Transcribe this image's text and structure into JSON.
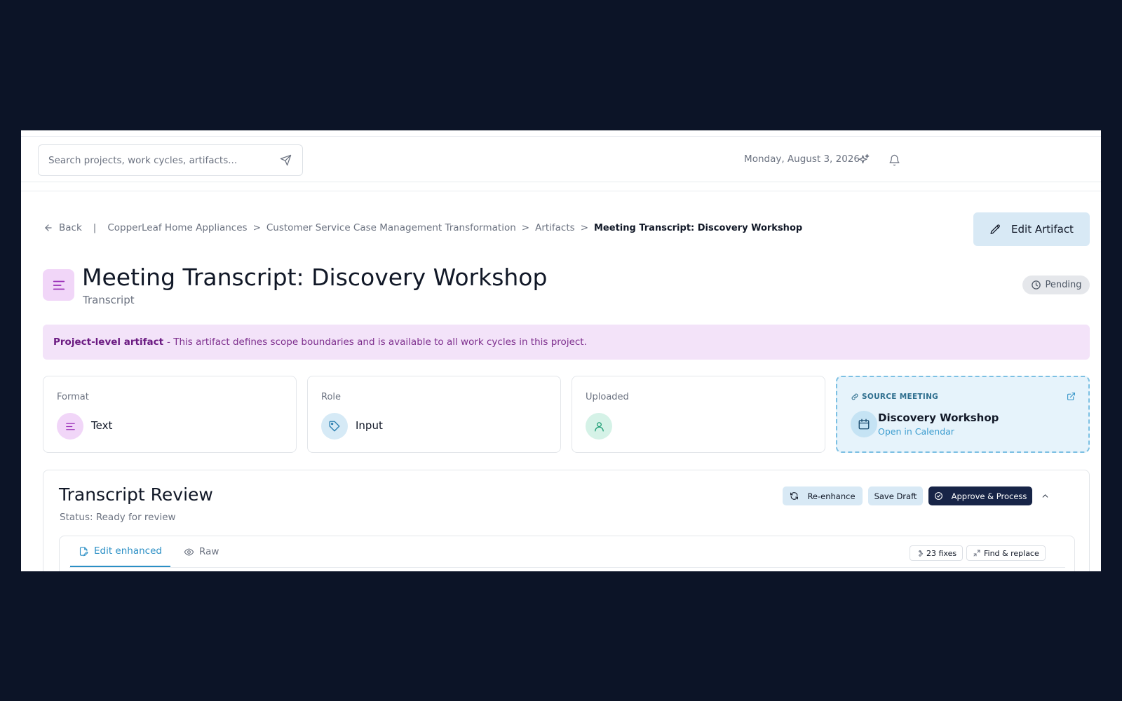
{
  "topbar": {
    "search_placeholder": "Search projects, work cycles, artifacts...",
    "date": "Monday, August 3, 2026",
    "icons": [
      "send-icon",
      "sparkles-icon",
      "bell-icon"
    ]
  },
  "breadcrumb": {
    "back": "Back",
    "separator": "|",
    "items": [
      "CopperLeaf Home Appliances",
      "Customer Service Case Management Transformation",
      "Artifacts"
    ],
    "current": "Meeting Transcript: Discovery Workshop",
    "chevron": ">"
  },
  "header": {
    "edit_button": "Edit Artifact",
    "title": "Meeting Transcript: Discovery Workshop",
    "subtitle": "Transcript",
    "status": "Pending"
  },
  "banner": {
    "strong": "Project-level artifact",
    "text": "- This artifact defines scope boundaries and is available to all work cycles in this project."
  },
  "cards": {
    "format": {
      "label": "Format",
      "value": "Text"
    },
    "role": {
      "label": "Role",
      "value": "Input"
    },
    "uploaded": {
      "label": "Uploaded",
      "value": ""
    }
  },
  "source_meeting": {
    "header": "SOURCE MEETING",
    "name": "Discovery Workshop",
    "link": "Open in Calendar"
  },
  "review": {
    "title": "Transcript Review",
    "status": "Status: Ready for review",
    "buttons": {
      "reenhance": "Re-enhance",
      "save_draft": "Save Draft",
      "approve": "Approve & Process"
    },
    "tabs": {
      "edit_enhanced": "Edit enhanced",
      "raw": "Raw"
    },
    "chips": {
      "fixes": "23 fixes",
      "find_replace": "Find & replace"
    }
  },
  "colors": {
    "background": "#0c1427",
    "accent_blue": "#2b8fc5",
    "light_blue_button": "#d8e9f5",
    "dark_button": "#172447",
    "banner_bg": "#f3e3f9",
    "banner_text": "#7e2f8e"
  }
}
